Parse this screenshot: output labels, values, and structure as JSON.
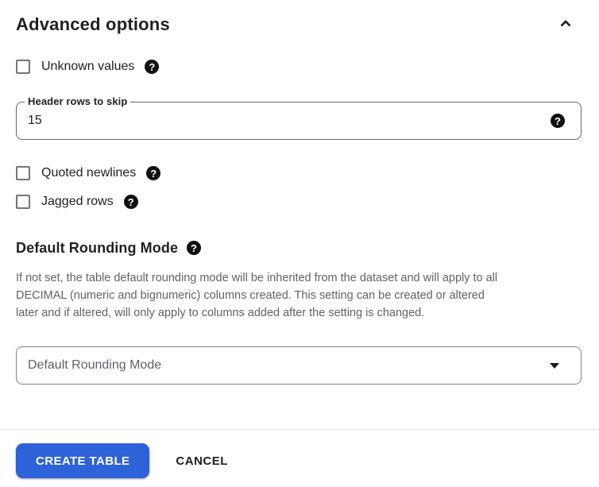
{
  "panel": {
    "title": "Advanced options"
  },
  "options": {
    "unknown_values": {
      "label": "Unknown values",
      "checked": false
    },
    "quoted_newlines": {
      "label": "Quoted newlines",
      "checked": false
    },
    "jagged_rows": {
      "label": "Jagged rows",
      "checked": false
    }
  },
  "header_rows_field": {
    "label": "Header rows to skip",
    "value": "15"
  },
  "rounding_section": {
    "heading": "Default Rounding Mode",
    "description_lines": [
      "If not set, the table default rounding mode will be inherited from the dataset and will apply to all",
      "DECIMAL (numeric and bignumeric) columns created. This setting can be created or altered",
      "later and if altered, will only apply to columns added after the setting is changed."
    ],
    "dropdown_value": "Default Rounding Mode"
  },
  "footer": {
    "create_button": "CREATE TABLE",
    "cancel_button": "CANCEL"
  },
  "icons": {
    "help_glyph": "?"
  },
  "colors": {
    "primary_button": "#2e62d9",
    "text_primary": "#202124",
    "text_secondary": "#5f6368",
    "checkbox_border": "#757575",
    "divider": "#e0e0e0"
  }
}
